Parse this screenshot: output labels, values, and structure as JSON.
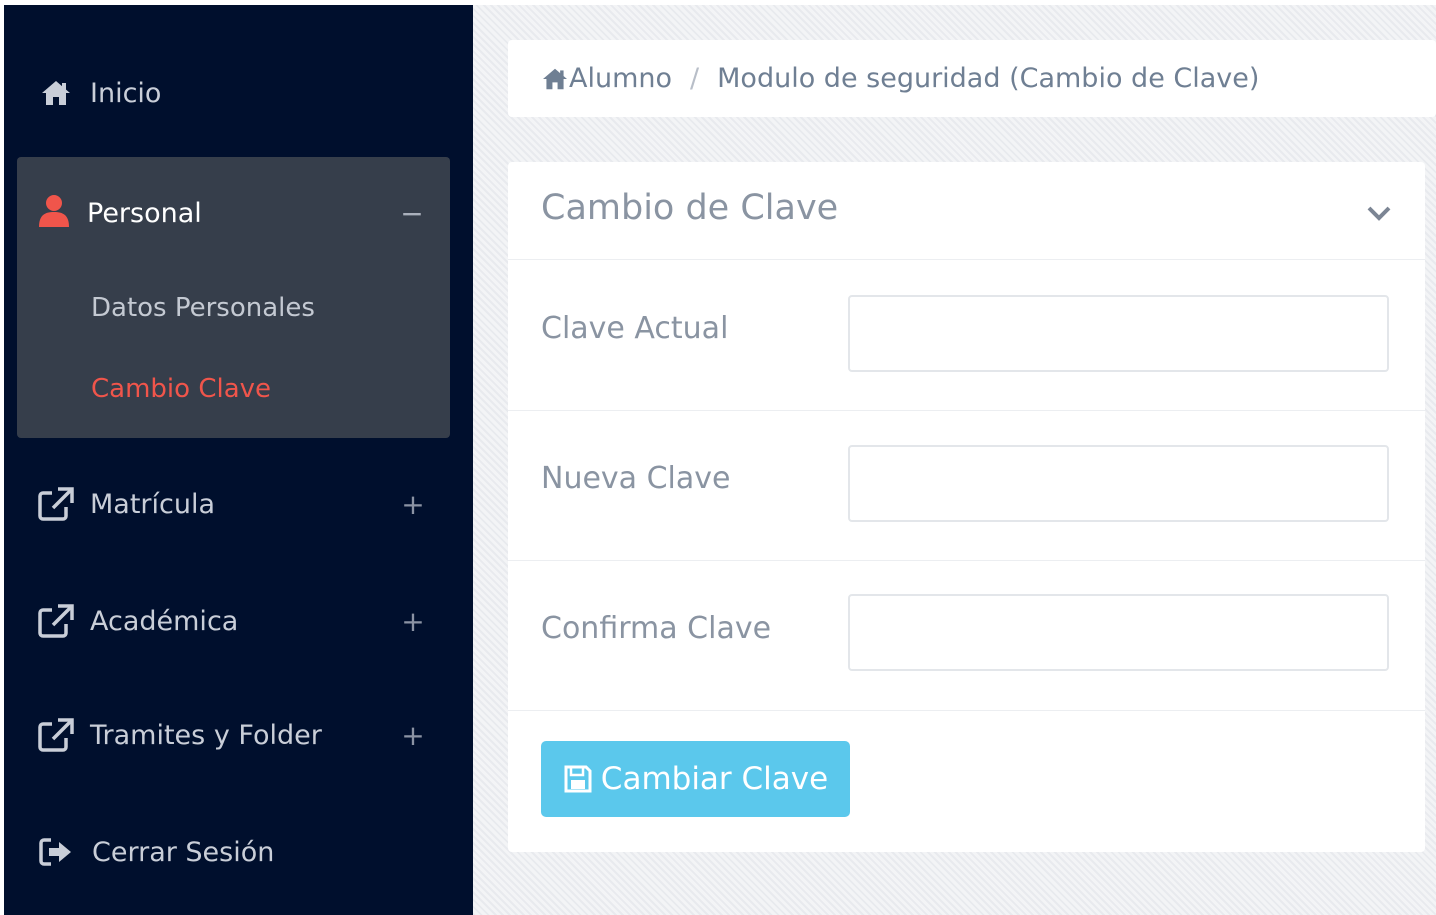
{
  "sidebar": {
    "inicio": {
      "label": "Inicio",
      "icon": "home-icon"
    },
    "personal": {
      "label": "Personal",
      "icon": "user-icon",
      "toggle": "−",
      "items": [
        {
          "label": "Datos Personales",
          "active": false
        },
        {
          "label": "Cambio Clave",
          "active": true
        }
      ]
    },
    "matricula": {
      "label": "Matrícula",
      "icon": "external-link-icon",
      "toggle": "+"
    },
    "academica": {
      "label": "Académica",
      "icon": "external-link-icon",
      "toggle": "+"
    },
    "tramites": {
      "label": "Tramites y Folder",
      "icon": "external-link-icon",
      "toggle": "+"
    },
    "cerrar": {
      "label": "Cerrar Sesión",
      "icon": "sign-out-icon"
    }
  },
  "breadcrumb": {
    "home": "Alumno",
    "separator": "/",
    "current": "Modulo de seguridad (Cambio de Clave)"
  },
  "card": {
    "title": "Cambio de Clave",
    "fields": [
      {
        "label": "Clave Actual",
        "value": ""
      },
      {
        "label": "Nueva Clave",
        "value": ""
      },
      {
        "label": "Confirma Clave",
        "value": ""
      }
    ],
    "submit_label": "Cambiar Clave"
  },
  "colors": {
    "sidebar_bg": "#000f2d",
    "active_group_bg": "#363e4b",
    "active_item": "#f0554b",
    "user_icon": "#f0554b",
    "button_bg": "#5bc8ec"
  }
}
